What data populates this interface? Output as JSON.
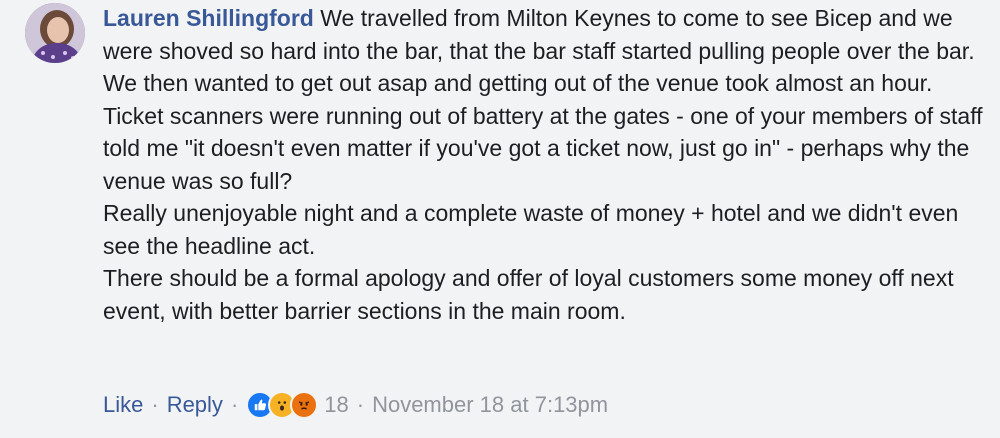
{
  "comment": {
    "author": "Lauren Shillingford",
    "paragraphs": [
      " We travelled from Milton Keynes to come to see Bicep and we were shoved so hard into the bar, that the bar staff started pulling people over the bar.",
      "We then wanted to get out asap and getting out of the venue took almost an hour.",
      "Ticket scanners were running out of battery at the gates - one of your members of staff told me \"it doesn't even matter if you've got a ticket now, just go in\" - perhaps why the venue was so full?",
      "Really unenjoyable night and a complete waste of money + hotel and we didn't even see the headline act.",
      "There should be a formal apology and offer of loyal customers some money off next event, with better barrier sections in the main room."
    ]
  },
  "actions": {
    "like_label": "Like",
    "separator": "·",
    "reply_label": "Reply",
    "reaction_count": "18",
    "timestamp": "November 18 at 7:13pm"
  },
  "reactions": [
    {
      "icon": "like-reaction-icon",
      "color": "#1877f2"
    },
    {
      "icon": "wow-reaction-icon",
      "color": "#f7b125"
    },
    {
      "icon": "angry-reaction-icon",
      "color": "#e9710f"
    }
  ]
}
